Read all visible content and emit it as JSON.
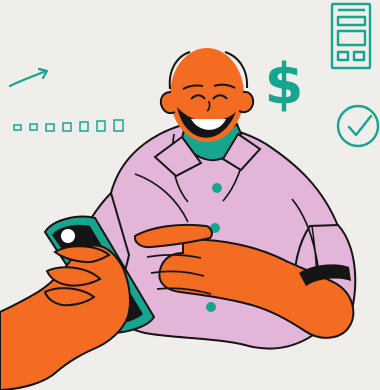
{
  "scene": {
    "background_color": "#efeeea",
    "accent_color": "#17a58f",
    "skin_color": "#f36c21",
    "shirt_color": "#e3b5d8",
    "outline_color": "#151515",
    "icons": [
      "trend-arrow-icon",
      "dashed-progress-icon",
      "dollar-sign-icon",
      "phone-app-icon",
      "checkmark-circle-icon"
    ],
    "dollar_symbol": "$"
  }
}
